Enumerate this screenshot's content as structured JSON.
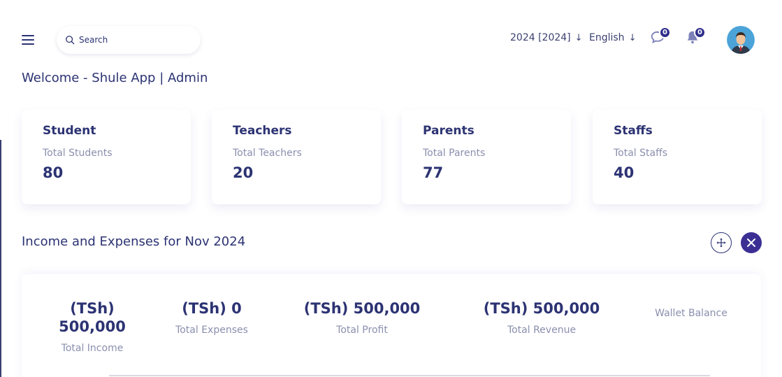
{
  "header": {
    "search_placeholder": "Search",
    "year_selector": "2024 [2024]",
    "language_selector": "English",
    "messages_count": "0",
    "notifications_count": "0"
  },
  "welcome": "Welcome - Shule App | Admin",
  "stats": [
    {
      "title": "Student",
      "subtitle": "Total Students",
      "value": "80"
    },
    {
      "title": "Teachers",
      "subtitle": "Total Teachers",
      "value": "20"
    },
    {
      "title": "Parents",
      "subtitle": "Total Parents",
      "value": "77"
    },
    {
      "title": "Staffs",
      "subtitle": "Total Staffs",
      "value": "40"
    }
  ],
  "finance": {
    "title": "Income and Expenses for Nov 2024",
    "income_amount_line1": "(TSh)",
    "income_amount_line2": "500,000",
    "income_label": "Total Income",
    "expenses_amount": "(TSh) 0",
    "expenses_label": "Total Expenses",
    "profit_amount": "(TSh) 500,000",
    "profit_label": "Total Profit",
    "revenue_amount": "(TSh) 500,000",
    "revenue_label": "Total Revenue",
    "wallet_label": "Wallet Balance"
  },
  "colors": {
    "primary": "#2c3373",
    "accent": "#3b2f94",
    "muted": "#8a8fae"
  }
}
